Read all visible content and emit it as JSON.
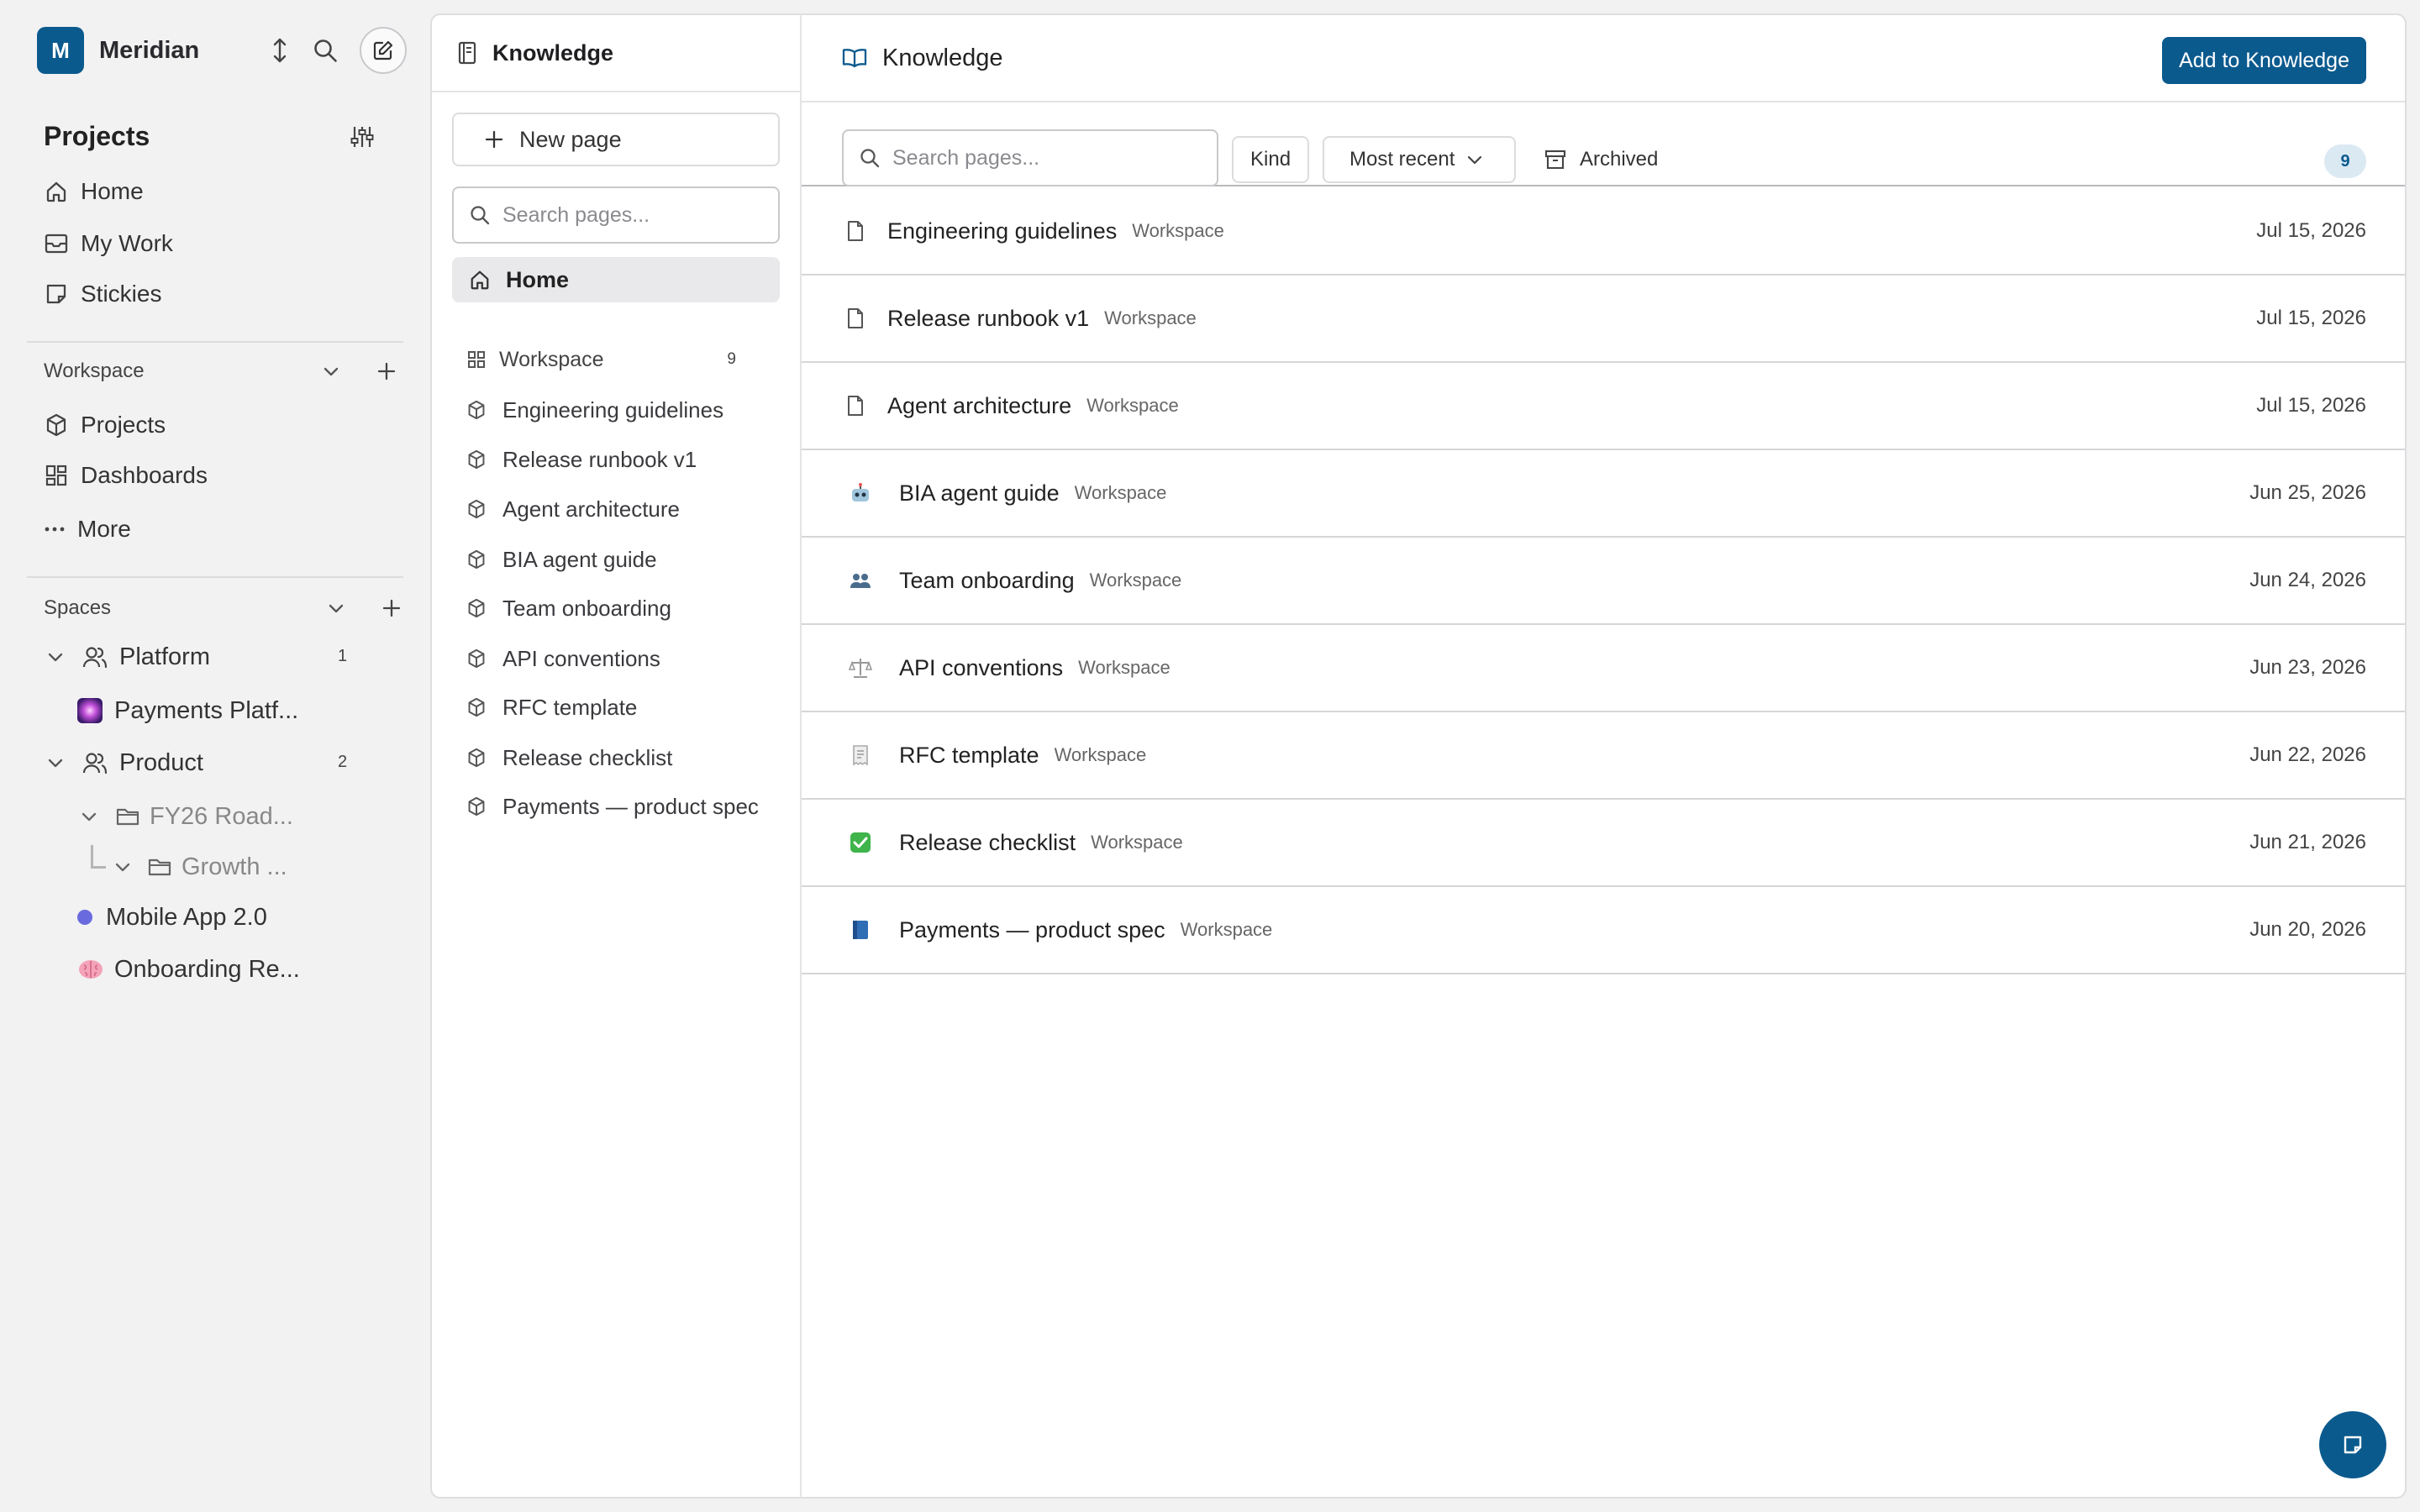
{
  "org": {
    "initial": "M",
    "name": "Meridian"
  },
  "sidebar": {
    "section_title": "Projects",
    "nav": [
      {
        "label": "Home",
        "icon": "home-icon"
      },
      {
        "label": "My Work",
        "icon": "inbox-icon"
      },
      {
        "label": "Stickies",
        "icon": "sticky-note-icon"
      }
    ],
    "workspace": {
      "title": "Workspace",
      "items": [
        {
          "label": "Projects",
          "icon": "cube-icon"
        },
        {
          "label": "Dashboards",
          "icon": "grid-icon"
        },
        {
          "label": "More",
          "icon": "dots-icon"
        }
      ]
    },
    "spaces": {
      "title": "Spaces",
      "platform": {
        "label": "Platform",
        "count": "1"
      },
      "payments": {
        "label": "Payments Platf..."
      },
      "product": {
        "label": "Product",
        "count": "2"
      },
      "fy26": {
        "label": "FY26 Road..."
      },
      "growth": {
        "label": "Growth ..."
      },
      "mobile": {
        "label": "Mobile App 2.0",
        "color": "#6a6adf"
      },
      "onboarding": {
        "label": "Onboarding Re..."
      }
    }
  },
  "tree": {
    "title": "Knowledge",
    "new_page": "New page",
    "search_placeholder": "Search pages...",
    "home": "Home",
    "workspace": {
      "label": "Workspace",
      "count": "9"
    },
    "items": [
      "Engineering guidelines",
      "Release runbook v1",
      "Agent architecture",
      "BIA agent guide",
      "Team onboarding",
      "API conventions",
      "RFC template",
      "Release checklist",
      "Payments — product spec"
    ]
  },
  "main": {
    "title": "Knowledge",
    "add_button": "Add to Knowledge",
    "search_placeholder": "Search pages...",
    "kind_label": "Kind",
    "sort_label": "Most recent",
    "archived_label": "Archived",
    "count": "9",
    "accent": "#0b5a8e",
    "rows": [
      {
        "title": "Engineering guidelines",
        "tag": "Workspace",
        "date": "Jul 15, 2026",
        "icon": "document-icon"
      },
      {
        "title": "Release runbook v1",
        "tag": "Workspace",
        "date": "Jul 15, 2026",
        "icon": "document-icon"
      },
      {
        "title": "Agent architecture",
        "tag": "Workspace",
        "date": "Jul 15, 2026",
        "icon": "document-icon"
      },
      {
        "title": "BIA agent guide",
        "tag": "Workspace",
        "date": "Jun 25, 2026",
        "icon": "robot-emoji-icon"
      },
      {
        "title": "Team onboarding",
        "tag": "Workspace",
        "date": "Jun 24, 2026",
        "icon": "people-emoji-icon"
      },
      {
        "title": "API conventions",
        "tag": "Workspace",
        "date": "Jun 23, 2026",
        "icon": "scales-emoji-icon"
      },
      {
        "title": "RFC template",
        "tag": "Workspace",
        "date": "Jun 22, 2026",
        "icon": "receipt-emoji-icon"
      },
      {
        "title": "Release checklist",
        "tag": "Workspace",
        "date": "Jun 21, 2026",
        "icon": "check-mark-emoji-icon"
      },
      {
        "title": "Payments — product spec",
        "tag": "Workspace",
        "date": "Jun 20, 2026",
        "icon": "blue-book-emoji-icon"
      }
    ]
  }
}
